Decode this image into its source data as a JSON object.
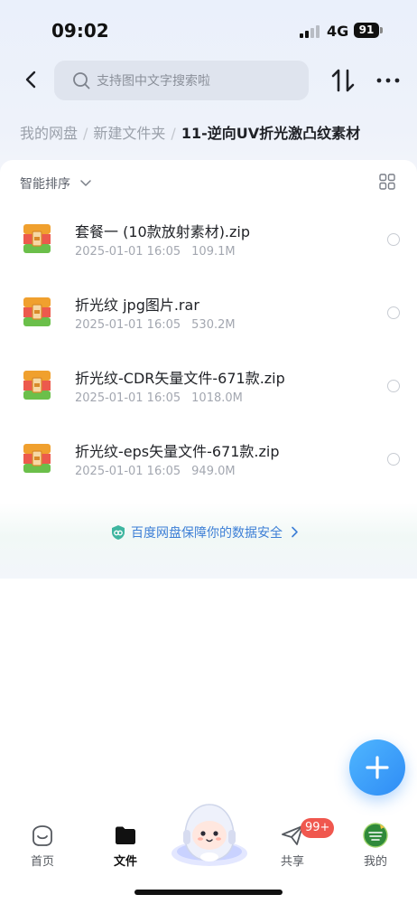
{
  "status_bar": {
    "time": "09:02",
    "network": "4G",
    "battery": "91"
  },
  "nav": {
    "search_placeholder": "支持图中文字搜索啦"
  },
  "breadcrumb": {
    "items": [
      "我的网盘",
      "新建文件夹"
    ],
    "separator": "/",
    "current": "11-逆向UV折光激凸纹素材"
  },
  "toolbar": {
    "sort_label": "智能排序"
  },
  "files": [
    {
      "name": "套餐一 (10款放射素材).zip",
      "date": "2025-01-01 16:05",
      "size": "109.1M"
    },
    {
      "name": "折光纹 jpg图片.rar",
      "date": "2025-01-01 16:05",
      "size": "530.2M"
    },
    {
      "name": "折光纹-CDR矢量文件-671款.zip",
      "date": "2025-01-01 16:05",
      "size": "1018.0M"
    },
    {
      "name": "折光纹-eps矢量文件-671款.zip",
      "date": "2025-01-01 16:05",
      "size": "949.0M"
    }
  ],
  "safety": {
    "text": "百度网盘保障你的数据安全"
  },
  "tabs": [
    {
      "label": "首页"
    },
    {
      "label": "文件"
    },
    {
      "label": "共享"
    },
    {
      "label": "我的"
    }
  ],
  "share_badge": "99+",
  "colors": {
    "accent": "#3d7fd6",
    "fab": "#2f8cf5",
    "badge": "#f0574e"
  }
}
